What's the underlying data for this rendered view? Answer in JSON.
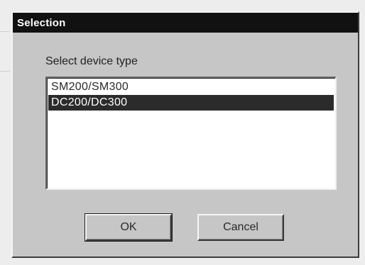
{
  "window": {
    "title": "Selection"
  },
  "group": {
    "label": "Select device type"
  },
  "device_list": {
    "items": [
      {
        "label": "SM200/SM300",
        "selected": false
      },
      {
        "label": "DC200/DC300",
        "selected": true
      }
    ]
  },
  "buttons": {
    "ok_label": "OK",
    "cancel_label": "Cancel"
  },
  "colors": {
    "title_bar": "#111111",
    "dialog_face": "#c6c6c6",
    "selection": "#2b2b2b"
  }
}
